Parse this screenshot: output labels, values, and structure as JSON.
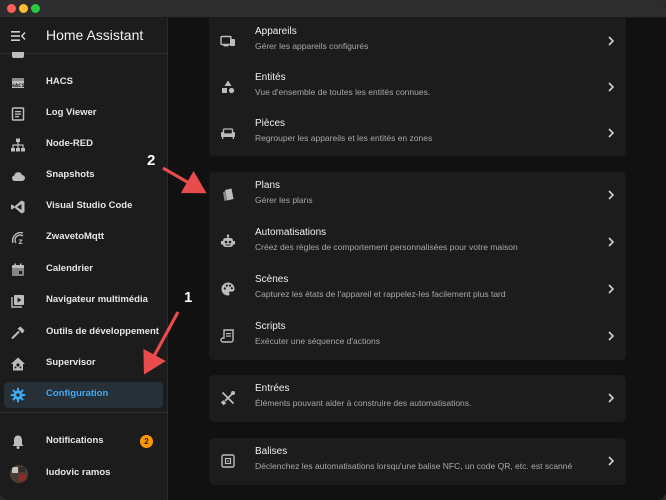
{
  "app": {
    "title": "Home Assistant"
  },
  "sidebar": {
    "items": [
      {
        "key": "hacs",
        "label": "HACS",
        "icon": "hacs-icon"
      },
      {
        "key": "logviewer",
        "label": "Log Viewer",
        "icon": "log-viewer-icon"
      },
      {
        "key": "nodered",
        "label": "Node-RED",
        "icon": "node-red-icon"
      },
      {
        "key": "snapshots",
        "label": "Snapshots",
        "icon": "cloud-icon"
      },
      {
        "key": "vscode",
        "label": "Visual Studio Code",
        "icon": "vscode-icon"
      },
      {
        "key": "zwave",
        "label": "ZwavetoMqtt",
        "icon": "zwave-icon"
      },
      {
        "key": "calendrier",
        "label": "Calendrier",
        "icon": "calendar-icon"
      },
      {
        "key": "media",
        "label": "Navigateur multimédia",
        "icon": "media-icon"
      },
      {
        "key": "devtools",
        "label": "Outils de développement",
        "icon": "hammer-icon"
      },
      {
        "key": "supervisor",
        "label": "Supervisor",
        "icon": "home-assistant-icon"
      },
      {
        "key": "configuration",
        "label": "Configuration",
        "icon": "gear-icon",
        "active": true
      }
    ],
    "notifications": {
      "label": "Notifications",
      "count": "2"
    },
    "user": {
      "name": "ludovic ramos"
    }
  },
  "cards": [
    {
      "rows": [
        {
          "title": "Appareils",
          "subtitle": "Gérer les appareils configurés",
          "icon": "devices-icon"
        },
        {
          "title": "Entités",
          "subtitle": "Vue d'ensemble de toutes les entités connues.",
          "icon": "shapes-icon"
        },
        {
          "title": "Pièces",
          "subtitle": "Regrouper les appareils et les entités en zones",
          "icon": "sofa-icon"
        }
      ]
    },
    {
      "rows": [
        {
          "title": "Plans",
          "subtitle": "Gérer les plans",
          "icon": "blueprint-icon"
        },
        {
          "title": "Automatisations",
          "subtitle": "Créez des règles de comportement personnalisées pour votre maison",
          "icon": "robot-icon"
        },
        {
          "title": "Scènes",
          "subtitle": "Capturez les états de l'appareil et rappelez-les facilement plus tard",
          "icon": "palette-icon"
        },
        {
          "title": "Scripts",
          "subtitle": "Exécuter une séquence d'actions",
          "icon": "script-icon"
        }
      ]
    },
    {
      "rows": [
        {
          "title": "Entrées",
          "subtitle": "Éléments pouvant aider à construire des automatisations.",
          "icon": "tools-icon"
        }
      ]
    },
    {
      "rows": [
        {
          "title": "Balises",
          "subtitle": "Déclenchez les automatisations lorsqu'une balise NFC, un code QR, etc. est scanné",
          "icon": "nfc-tag-icon"
        }
      ]
    }
  ],
  "annotations": [
    {
      "label": "1"
    },
    {
      "label": "2"
    }
  ],
  "colors": {
    "accent": "#3ea9f5",
    "badge": "#ff9800",
    "arrow": "#e84c4c"
  }
}
